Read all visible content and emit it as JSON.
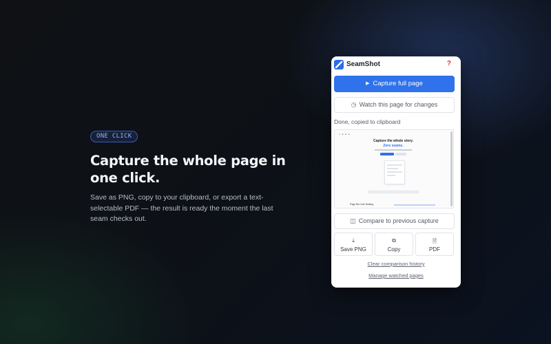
{
  "hero": {
    "badge": "ONE CLICK",
    "title": "Capture the whole page in one click.",
    "description": "Save as PNG, copy to your clipboard, or export a text-selectable PDF — the result is ready the moment the last seam checks out."
  },
  "popup": {
    "app_name": "SeamShot",
    "help_label": "?",
    "capture_button": "Capture full page",
    "watch_button": "Watch this page for changes",
    "status": "Done, copied to clipboard",
    "preview": {
      "title": "Capture the whole story.",
      "subtitle": "Zero seams.",
      "section_label": "Page Ba Cost Scaling"
    },
    "compare_button": "Compare to previous capture",
    "actions": [
      {
        "label": "Save PNG",
        "icon": "download-icon"
      },
      {
        "label": "Copy",
        "icon": "copy-icon"
      },
      {
        "label": "PDF",
        "icon": "document-icon"
      }
    ],
    "clear_history_link": "Clear comparison history",
    "manage_link": "Manage watched pages"
  },
  "colors": {
    "accent": "#2f72eb",
    "help": "#d9342b",
    "badge_text": "#8fb0ff"
  }
}
